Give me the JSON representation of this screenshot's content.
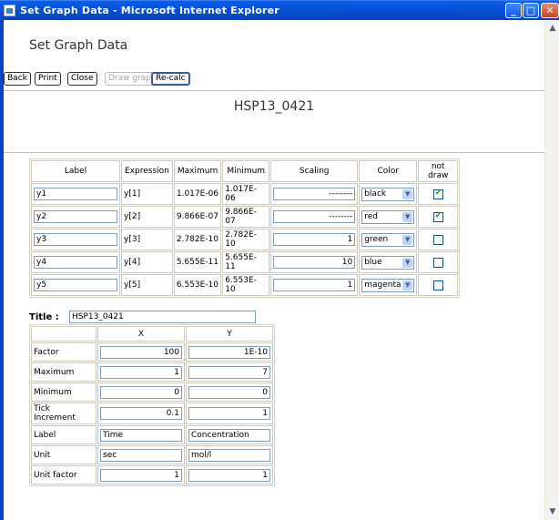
{
  "window": {
    "title": "Set Graph Data - Microsoft Internet Explorer",
    "min": "_",
    "max": "□",
    "close": "✕"
  },
  "page": {
    "heading": "Set Graph Data",
    "doc_title": "HSP13_0421"
  },
  "toolbar": {
    "back": "Back",
    "print": "Print",
    "close": "Close",
    "draw_graph": "Draw graph",
    "recalc": "Re-calc"
  },
  "series_table": {
    "headers": [
      "Label",
      "Expression",
      "Maximum",
      "Minimum",
      "Scaling",
      "Color",
      "not draw"
    ],
    "rows": [
      {
        "label": "y1",
        "expression": "y[1]",
        "maximum": "1.017E-06",
        "minimum": "1.017E-06",
        "scaling": "--------",
        "color": "black",
        "not_draw": true
      },
      {
        "label": "y2",
        "expression": "y[2]",
        "maximum": "9.866E-07",
        "minimum": "9.866E-07",
        "scaling": "--------",
        "color": "red",
        "not_draw": true
      },
      {
        "label": "y3",
        "expression": "y[3]",
        "maximum": "2.782E-10",
        "minimum": "2.782E-10",
        "scaling": "1",
        "color": "green",
        "not_draw": false
      },
      {
        "label": "y4",
        "expression": "y[4]",
        "maximum": "5.655E-11",
        "minimum": "5.655E-11",
        "scaling": "10",
        "color": "blue",
        "not_draw": false
      },
      {
        "label": "y5",
        "expression": "y[5]",
        "maximum": "6.553E-10",
        "minimum": "6.553E-10",
        "scaling": "1",
        "color": "magenta",
        "not_draw": false
      }
    ]
  },
  "graph_title": {
    "label": "Title :",
    "value": "HSP13_0421"
  },
  "axis_table": {
    "headers": [
      "",
      "X",
      "Y"
    ],
    "rows": [
      {
        "label": "Factor",
        "x": "100",
        "y": "1E-10",
        "align": "right"
      },
      {
        "label": "Maximum",
        "x": "1",
        "y": "7",
        "align": "right"
      },
      {
        "label": "Minimum",
        "x": "0",
        "y": "0",
        "align": "right"
      },
      {
        "label": "Tick Increment",
        "x": "0.1",
        "y": "1",
        "align": "right"
      },
      {
        "label": "Label",
        "x": "Time",
        "y": "Concentration",
        "align": "left"
      },
      {
        "label": "Unit",
        "x": "sec",
        "y": "mol/l",
        "align": "left"
      },
      {
        "label": "Unit factor",
        "x": "1",
        "y": "1",
        "align": "right"
      }
    ]
  },
  "icons": {
    "scroll_up": "▲",
    "scroll_down": "▼",
    "dropdown": "▼"
  },
  "colors": {
    "titlebar": "#0950d8",
    "close_button": "#c8422a",
    "checkbox_check": "#21a121"
  }
}
